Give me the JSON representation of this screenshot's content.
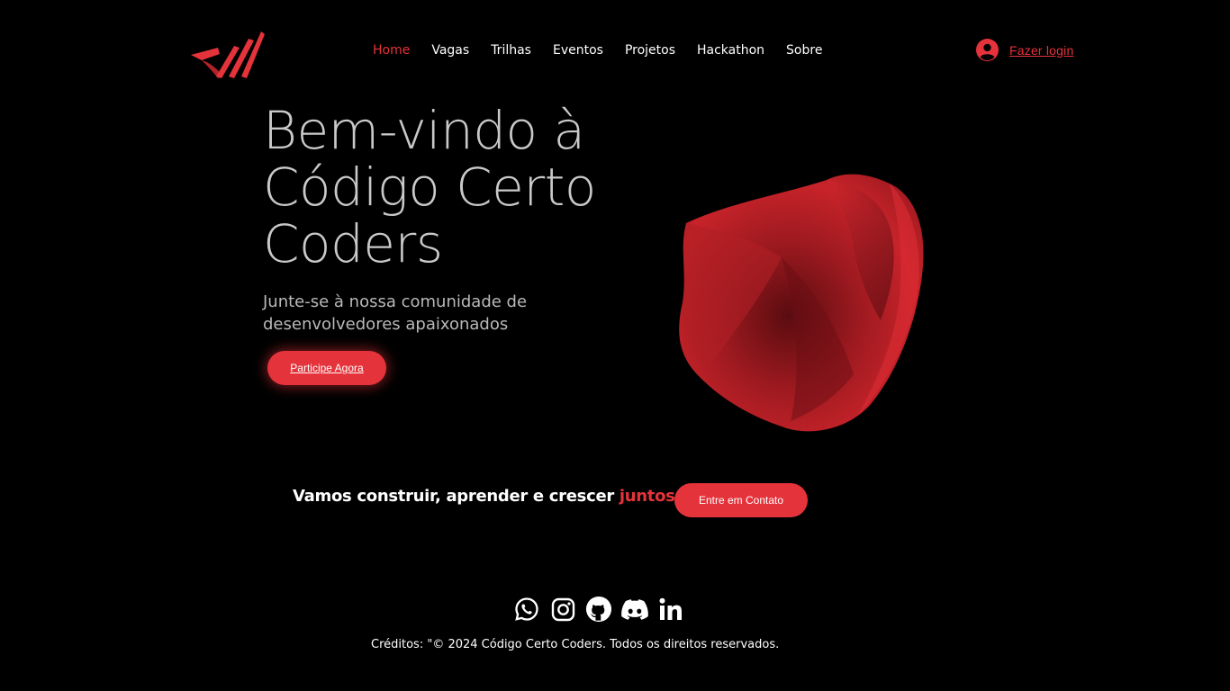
{
  "header": {
    "nav": [
      {
        "label": "Home",
        "active": true
      },
      {
        "label": "Vagas",
        "active": false
      },
      {
        "label": "Trilhas",
        "active": false
      },
      {
        "label": "Eventos",
        "active": false
      },
      {
        "label": "Projetos",
        "active": false
      },
      {
        "label": "Hackathon",
        "active": false
      },
      {
        "label": "Sobre",
        "active": false
      }
    ],
    "login_label": "Fazer login"
  },
  "hero": {
    "title_lines": [
      "Bem-vindo à",
      "Código Certo",
      "Coders"
    ],
    "subtitle": "Junte-se à nossa comunidade de desenvolvedores apaixonados",
    "join_button": "Participe Agora"
  },
  "cta": {
    "text": "Vamos construir, aprender e crescer",
    "highlight": "juntos !",
    "contact_button": "Entre em Contato"
  },
  "footer": {
    "social_icons": [
      "whatsapp-icon",
      "instagram-icon",
      "github-icon",
      "discord-icon",
      "linkedin-icon"
    ],
    "credits": "Créditos: \"© 2024 Código Certo Coders. Todos os direitos reservados."
  },
  "colors": {
    "accent": "#e5333b",
    "background": "#000000",
    "title_text": "#c9c9c9"
  }
}
